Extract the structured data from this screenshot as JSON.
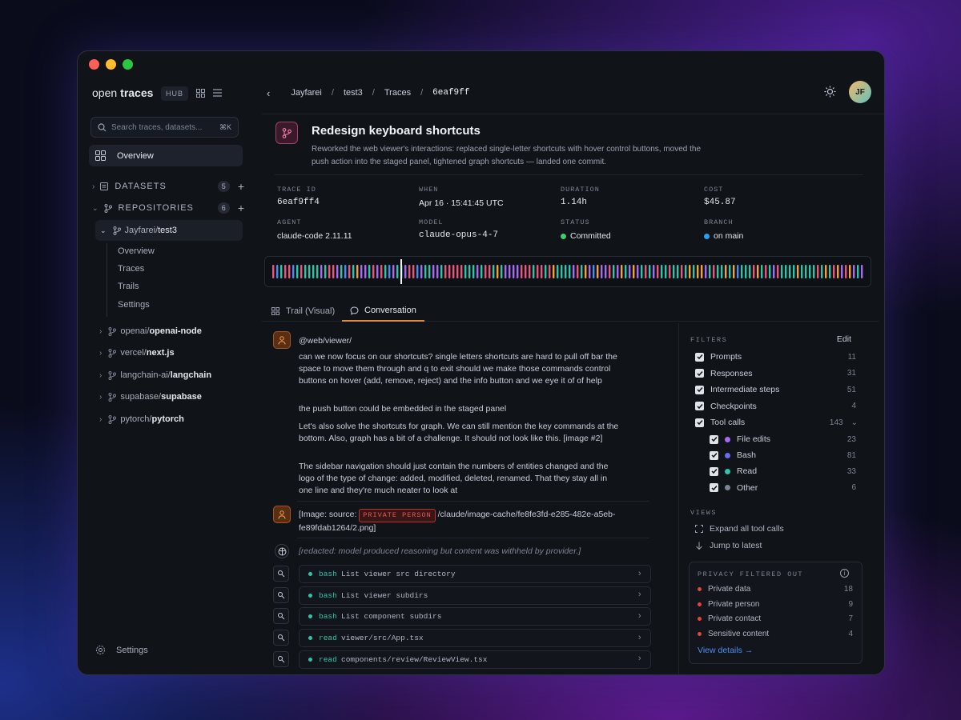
{
  "sidebar": {
    "brand_light": "open",
    "brand_bold": "traces",
    "hub": "HUB",
    "search_placeholder": "Search traces, datasets...",
    "search_kbd": "⌘K",
    "overview": "Overview",
    "datasets_label": "DATASETS",
    "datasets_count": "5",
    "repos_label": "REPOSITORIES",
    "repos_count": "6",
    "selected_repo": {
      "owner": "Jayfarei/",
      "name": "test3"
    },
    "repo_subnav": [
      "Overview",
      "Traces",
      "Trails",
      "Settings"
    ],
    "repos": [
      {
        "owner": "openai/",
        "name": "openai-node"
      },
      {
        "owner": "vercel/",
        "name": "next.js"
      },
      {
        "owner": "langchain-ai/",
        "name": "langchain"
      },
      {
        "owner": "supabase/",
        "name": "supabase"
      },
      {
        "owner": "pytorch/",
        "name": "pytorch"
      }
    ],
    "settings": "Settings"
  },
  "header": {
    "breadcrumb": [
      "Jayfarei",
      "test3",
      "Traces",
      "6eaf9ff"
    ],
    "avatar": "JF"
  },
  "trace": {
    "title": "Redesign keyboard shortcuts",
    "description": "Reworked the web viewer's interactions: replaced single-letter shortcuts with hover control buttons, moved the push action into the staged panel, tightened graph shortcuts — landed one commit.",
    "meta": [
      {
        "label": "TRACE ID",
        "value": "6eaf9ff4"
      },
      {
        "label": "WHEN",
        "value": "Apr 16 · 15:41:45 UTC"
      },
      {
        "label": "DURATION",
        "value": "1.14h"
      },
      {
        "label": "COST",
        "value": "$45.87"
      },
      {
        "label": "AGENT",
        "value": "claude-code 2.11.11"
      },
      {
        "label": "MODEL",
        "value": "claude-opus-4-7"
      },
      {
        "label": "STATUS",
        "value": "Committed"
      },
      {
        "label": "BRANCH",
        "value": "on main"
      }
    ]
  },
  "colors": {
    "accent": "#e08a3a",
    "status": "#3ecf6a",
    "branch": "#2d9cf0",
    "teal": "#2fc3a8",
    "pink": "#e8567d",
    "purple": "#a66bf0",
    "orange": "#f0a23a",
    "blue": "#4a8bf0"
  },
  "tabs": [
    "Trail (Visual)",
    "Conversation"
  ],
  "conversation": {
    "path": "@web/viewer/",
    "paragraphs": [
      "can we now focus on our shortcuts? single letters shortcuts are hard to pull off bar the space to move them through and q to exit should we make those commands control buttons on hover (add, remove, reject) and the info button and we eye it of of help",
      "the push button could be embedded in the staged panel",
      "Let's also solve the shortcuts for graph. We can still mention the key commands at the bottom. Also, graph has a bit of a challenge. It should not look like this. [image #2]",
      "The sidebar navigation should just contain the numbers of entities changed and the logo of the type of change: added, modified, deleted, renamed. That they stay all in one line and they're much neater to look at"
    ],
    "image_prefix": "[Image: source:",
    "image_tag": "PRIVATE PERSON",
    "image_path": "/claude/image-cache/fe8fe3fd-e285-482e-a5eb-fe89fdab1264/2.png]",
    "redacted": "[redacted: model produced reasoning but content was withheld by provider.]",
    "tools": [
      {
        "type": "bash",
        "desc": "List viewer src directory"
      },
      {
        "type": "bash",
        "desc": "List viewer subdirs"
      },
      {
        "type": "bash",
        "desc": "List component subdirs"
      },
      {
        "type": "read",
        "desc": "viewer/src/App.tsx"
      },
      {
        "type": "read",
        "desc": "components/review/ReviewView.tsx"
      }
    ]
  },
  "filters": {
    "header": "FILTERS",
    "edit": "Edit",
    "items": [
      {
        "label": "Prompts",
        "count": "11"
      },
      {
        "label": "Responses",
        "count": "31"
      },
      {
        "label": "Intermediate steps",
        "count": "51"
      },
      {
        "label": "Checkpoints",
        "count": "4"
      },
      {
        "label": "Tool calls",
        "count": "143"
      }
    ],
    "tool_items": [
      {
        "label": "File edits",
        "count": "23",
        "color": "#a66bf0"
      },
      {
        "label": "Bash",
        "count": "81",
        "color": "#6b6bf0"
      },
      {
        "label": "Read",
        "count": "33",
        "color": "#2fc3a8"
      },
      {
        "label": "Other",
        "count": "6",
        "color": "#7d8494"
      }
    ],
    "views_header": "VIEWS",
    "expand": "Expand all tool calls",
    "jump": "Jump to latest",
    "privacy_header": "PRIVACY FILTERED OUT",
    "privacy": [
      {
        "label": "Private data",
        "count": "18"
      },
      {
        "label": "Private person",
        "count": "9"
      },
      {
        "label": "Private contact",
        "count": "7"
      },
      {
        "label": "Sensitive content",
        "count": "4"
      }
    ],
    "view_details": "View details →"
  }
}
